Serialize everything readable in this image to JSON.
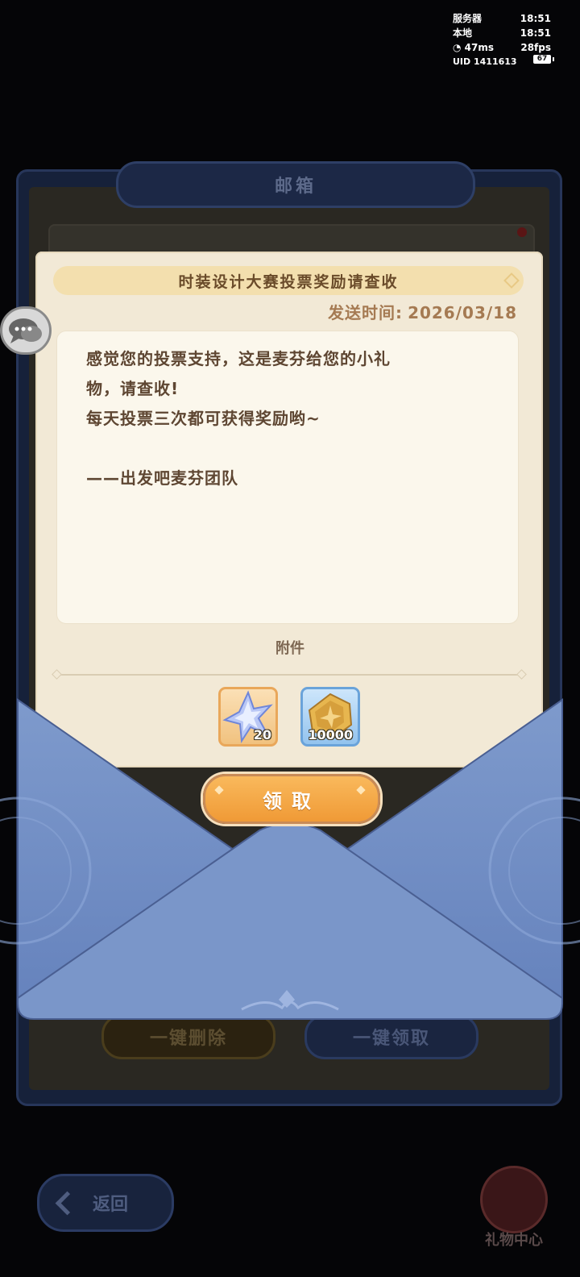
{
  "status": {
    "server_label": "服务器",
    "server_time": "18:51",
    "local_label": "本地",
    "local_time": "18:51",
    "ping": "47ms",
    "fps": "28fps",
    "uid_label": "UID",
    "uid": "1411613",
    "battery": "67"
  },
  "mailbox": {
    "title": "邮箱",
    "delete_all_label": "一键删除",
    "claim_all_label": "一键领取"
  },
  "footer": {
    "back_label": "返回",
    "gift_center_label": "礼物中心"
  },
  "mail": {
    "title": "时装设计大赛投票奖励请查收",
    "send_time_label": "发送时间:",
    "send_time": "2026/03/18",
    "body_lines": [
      "感觉您的投票支持，这是麦芬给您的小礼",
      "物，请查收!",
      "每天投票三次都可获得奖励哟~",
      "",
      "——出发吧麦芬团队"
    ],
    "attachments_label": "附件",
    "attachments": [
      {
        "icon": "star-crystal-icon",
        "count": "20"
      },
      {
        "icon": "gold-coin-icon",
        "count": "10000"
      }
    ],
    "claim_label": "领取"
  },
  "colors": {
    "paper": "#f2e9d6",
    "title_bar": "#f3dfae",
    "envelope": "#7a96c9",
    "claim_button": "#f4a849"
  }
}
